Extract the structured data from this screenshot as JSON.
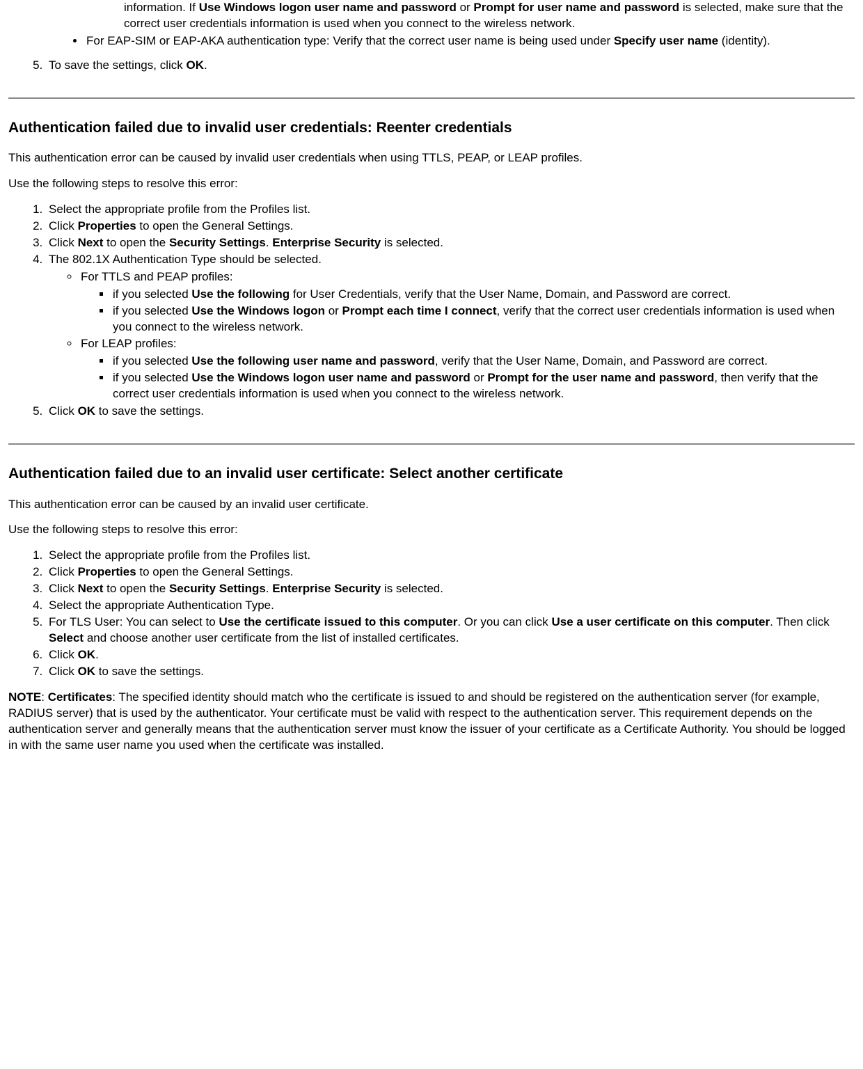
{
  "top": {
    "cont1_a": "information. If ",
    "cont1_b1": "Use Windows logon user name and password",
    "cont1_c": " or ",
    "cont1_b2": "Prompt for user name and password",
    "cont1_d": " is selected, make sure that the correct user credentials information is used when you connect to the wireless network.",
    "bullet_a": "For EAP-SIM or EAP-AKA authentication type: Verify that the correct user name is being used under ",
    "bullet_b": "Specify user name",
    "bullet_c": " (identity).",
    "step5_a": "To save the settings, click ",
    "step5_b": "OK",
    "step5_c": "."
  },
  "sec1": {
    "title": "Authentication failed due to invalid user credentials: Reenter credentials",
    "intro": "This authentication error can be caused by invalid user credentials when using TTLS, PEAP, or LEAP profiles.",
    "lead": "Use the following steps to resolve this error:",
    "s1": "Select the appropriate profile from the Profiles list.",
    "s2_a": "Click ",
    "s2_b": "Properties",
    "s2_c": " to open the General Settings.",
    "s3_a": "Click ",
    "s3_b": "Next",
    "s3_c": " to open the ",
    "s3_d": "Security Settings",
    "s3_e": ". ",
    "s3_f": "Enterprise Security",
    "s3_g": " is selected.",
    "s4": "The 802.1X Authentication Type should be selected.",
    "s4_ttls_head": "For TTLS and PEAP profiles:",
    "s4_ttls_i_a": "if you selected ",
    "s4_ttls_i_b": "Use the following",
    "s4_ttls_i_c": " for User Credentials, verify that the User Name, Domain, and Password are correct.",
    "s4_ttls_ii_a": "if you selected ",
    "s4_ttls_ii_b": "Use the Windows logon",
    "s4_ttls_ii_c": " or ",
    "s4_ttls_ii_d": "Prompt each time I connect",
    "s4_ttls_ii_e": ", verify that the correct user credentials information is used when you connect to the wireless network.",
    "s4_leap_head": "For LEAP profiles:",
    "s4_leap_i_a": "if you selected ",
    "s4_leap_i_b": "Use the following user name and password",
    "s4_leap_i_c": ", verify that the User Name, Domain, and Password are correct.",
    "s4_leap_ii_a": "if you selected ",
    "s4_leap_ii_b": "Use the Windows logon user name and password",
    "s4_leap_ii_c": " or ",
    "s4_leap_ii_d": "Prompt for the user name and password",
    "s4_leap_ii_e": ", then verify that the correct user credentials information is used when you connect to the wireless network.",
    "s5_a": "Click ",
    "s5_b": "OK",
    "s5_c": " to save the settings."
  },
  "sec2": {
    "title": "Authentication failed due to an invalid user certificate: Select another certificate",
    "intro": "This authentication error can be caused by an invalid user certificate.",
    "lead": "Use the following steps to resolve this error:",
    "s1": "Select the appropriate profile from the Profiles list.",
    "s2_a": "Click ",
    "s2_b": "Properties",
    "s2_c": " to open the General Settings.",
    "s3_a": "Click ",
    "s3_b": "Next",
    "s3_c": " to open the ",
    "s3_d": "Security Settings",
    "s3_e": ". ",
    "s3_f": "Enterprise Security",
    "s3_g": " is selected.",
    "s4": "Select the appropriate Authentication Type.",
    "s5_a": "For TLS User: You can select to ",
    "s5_b": "Use the certificate issued to this computer",
    "s5_c": ". Or you can click ",
    "s5_d": "Use a user certificate on this computer",
    "s5_e": ". Then click ",
    "s5_f": "Select",
    "s5_g": " and choose another user certificate from the list of installed certificates.",
    "s6_a": "Click ",
    "s6_b": "OK",
    "s6_c": ".",
    "s7_a": "Click ",
    "s7_b": "OK",
    "s7_c": " to save the settings.",
    "note_a": "NOTE",
    "note_b": ": ",
    "note_c": "Certificates",
    "note_d": ": The specified identity should match who the certificate is issued to and should be registered on the authentication server (for example, RADIUS server) that is used by the authenticator. Your certificate must be valid with respect to the authentication server. This requirement depends on the authentication server and generally means that the authentication server must know the issuer of your certificate as a Certificate Authority. You should be logged in with the same user name you used when the certificate was installed."
  }
}
